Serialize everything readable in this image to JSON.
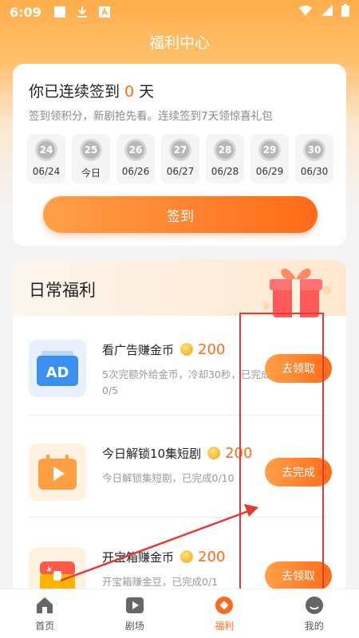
{
  "status_bar": {
    "time": "6:09"
  },
  "header": {
    "title": "福利中心"
  },
  "signin": {
    "heading_prefix": "你已连续签到",
    "streak": "0",
    "heading_suffix": "天",
    "subtitle": "签到领积分，新剧抢先看。连续签到7天领惊喜礼包",
    "days": [
      {
        "num": "24",
        "label": "06/24"
      },
      {
        "num": "25",
        "label": "今日"
      },
      {
        "num": "26",
        "label": "06/26"
      },
      {
        "num": "27",
        "label": "06/27"
      },
      {
        "num": "28",
        "label": "06/28"
      },
      {
        "num": "29",
        "label": "06/29"
      },
      {
        "num": "30",
        "label": "06/30"
      }
    ],
    "button": "签到"
  },
  "daily": {
    "title": "日常福利",
    "tasks": [
      {
        "name": "看广告赚金币",
        "amount": "200",
        "desc": "5次完额外给金币，冷却30秒，已完成0/5",
        "button": "去领取",
        "icon": "ad-icon"
      },
      {
        "name": "今日解锁10集短剧",
        "amount": "200",
        "desc": "今日解锁集短剧，已完成0/10",
        "button": "去完成",
        "icon": "video-calendar-icon"
      },
      {
        "name": "开宝箱赚金币",
        "amount": "200",
        "desc": "开宝箱赚金豆，已完成0/1",
        "button": "去领取",
        "icon": "treasure-chest-icon"
      }
    ]
  },
  "tabbar": {
    "items": [
      {
        "label": "首页",
        "icon": "home-icon"
      },
      {
        "label": "剧场",
        "icon": "play-icon"
      },
      {
        "label": "福利",
        "icon": "gift-icon"
      },
      {
        "label": "我的",
        "icon": "profile-icon"
      }
    ],
    "active_index": 2
  },
  "colors": {
    "accent": "#ff6a1a",
    "annotation": "#e53935"
  }
}
